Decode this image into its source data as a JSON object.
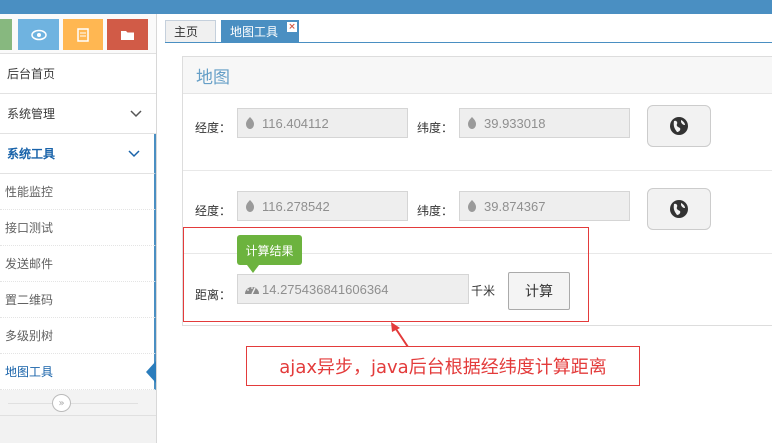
{
  "sidebar": {
    "items": [
      {
        "label": "后台首页"
      },
      {
        "label": "系统管理"
      },
      {
        "label": "系统工具"
      }
    ],
    "sub_items": [
      {
        "label": "性能监控"
      },
      {
        "label": "接口测试"
      },
      {
        "label": "发送邮件"
      },
      {
        "label": "置二维码"
      },
      {
        "label": "多级别树"
      },
      {
        "label": "地图工具"
      }
    ],
    "collapse_glyph": "»"
  },
  "tabs": [
    {
      "label": "主页"
    },
    {
      "label": "地图工具"
    }
  ],
  "tab_close_glyph": "×",
  "panel": {
    "title": "地图",
    "point1": {
      "lng_label": "经度：",
      "lng_value": "116.404112",
      "lat_label": "纬度：",
      "lat_value": "39.933018"
    },
    "point2": {
      "lng_label": "经度：",
      "lng_value": "116.278542",
      "lat_label": "纬度：",
      "lat_value": "39.874367"
    },
    "distance_label": "距离：",
    "distance_value": "14.275436841606364",
    "distance_unit": "千米",
    "calc_button": "计算",
    "tooltip": "计算结果"
  },
  "annotation": "ajax异步，java后台根据经纬度计算距离",
  "colors": {
    "primary": "#4a8fc2",
    "annotation": "#e33b3b",
    "tooltip": "#6cb33e"
  }
}
